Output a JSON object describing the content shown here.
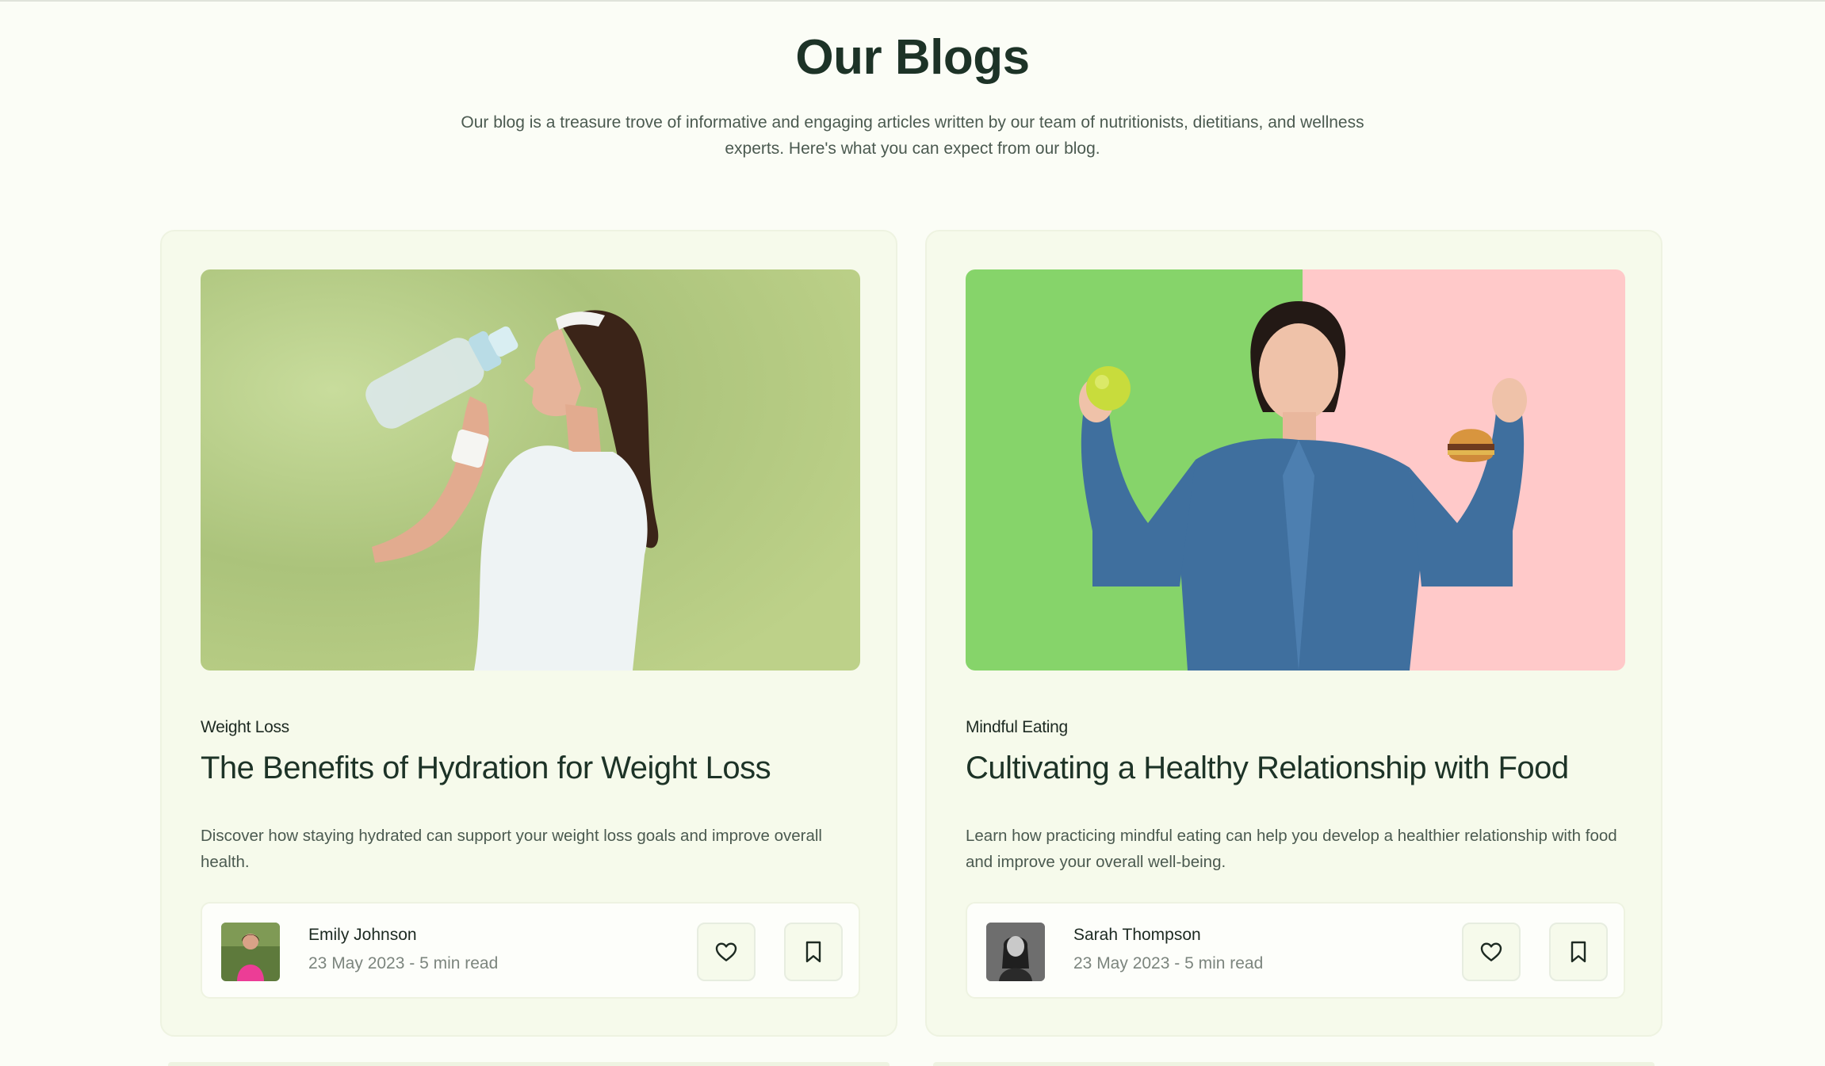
{
  "section": {
    "title": "Our Blogs",
    "subtitle": "Our blog is a treasure trove of informative and engaging articles written by our team of nutritionists, dietitians, and wellness experts. Here's what you can expect from our blog."
  },
  "posts": [
    {
      "category": "Weight Loss",
      "title": "The Benefits of Hydration for Weight Loss",
      "description": "Discover how staying hydrated can support your weight loss goals and improve overall health.",
      "author": "Emily Johnson",
      "meta": "23 May 2023 - 5 min read",
      "like_icon": "heart-icon",
      "save_icon": "bookmark-icon"
    },
    {
      "category": "Mindful Eating",
      "title": "Cultivating a Healthy Relationship with Food",
      "description": "Learn how practicing mindful eating can help you develop a healthier relationship with food and improve your overall well-being.",
      "author": "Sarah Thompson",
      "meta": "23 May 2023 - 5 min read",
      "like_icon": "heart-icon",
      "save_icon": "bookmark-icon"
    }
  ],
  "colors": {
    "background": "#fbfdf6",
    "card": "#f6faeb",
    "heading": "#1d3327",
    "body_text": "#4b5a50"
  }
}
